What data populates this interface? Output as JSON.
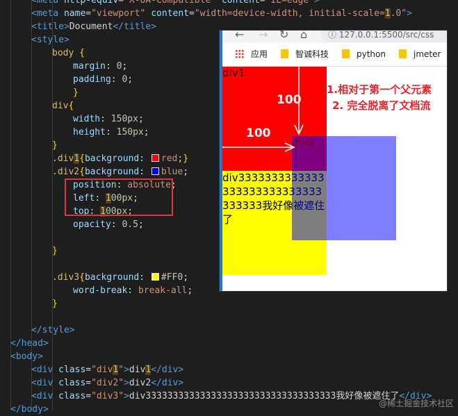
{
  "editor": {
    "lines": [
      [
        [
          "tag",
          "<meta"
        ],
        [
          "attr",
          " http-equiv"
        ],
        [
          "txt",
          "="
        ],
        [
          "str",
          "\"X-UA-Compatible\""
        ],
        [
          "attr",
          " content"
        ],
        [
          "txt",
          "="
        ],
        [
          "str",
          "\"IE=edge\""
        ],
        [
          "tag",
          ">"
        ]
      ],
      [
        [
          "tag",
          "<meta"
        ],
        [
          "attr",
          " name"
        ],
        [
          "txt",
          "="
        ],
        [
          "str",
          "\"viewport\""
        ],
        [
          "attr",
          " content"
        ],
        [
          "txt",
          "="
        ],
        [
          "str",
          "\"width=device-width, initial-scale="
        ],
        [
          "hlnum",
          "1"
        ],
        [
          "str",
          ".0\""
        ],
        [
          "tag",
          ">"
        ]
      ],
      [
        [
          "tag",
          "<title>"
        ],
        [
          "txt",
          "Document"
        ],
        [
          "tag",
          "</title>"
        ]
      ],
      [
        [
          "tag",
          "<style>"
        ]
      ],
      [
        [
          "sel",
          "body"
        ],
        [
          "br",
          " {"
        ]
      ],
      [
        [
          "prop",
          "margin"
        ],
        [
          "txt",
          ": "
        ],
        [
          "num",
          "0"
        ],
        [
          "txt",
          ";"
        ]
      ],
      [
        [
          "prop",
          "padding"
        ],
        [
          "txt",
          ": "
        ],
        [
          "num",
          "0"
        ],
        [
          "txt",
          ";"
        ]
      ],
      [
        [
          "br",
          "}"
        ]
      ],
      [
        [
          "sel",
          "div"
        ],
        [
          "br",
          "{"
        ]
      ],
      [
        [
          "prop",
          "width"
        ],
        [
          "txt",
          ": "
        ],
        [
          "num",
          "150px"
        ],
        [
          "txt",
          ";"
        ]
      ],
      [
        [
          "prop",
          "height"
        ],
        [
          "txt",
          ": "
        ],
        [
          "num",
          "150px"
        ],
        [
          "txt",
          ";"
        ]
      ],
      [
        [
          "br",
          "}"
        ]
      ],
      [
        [
          "sel",
          ".div"
        ],
        [
          "hlnum",
          "1"
        ],
        [
          "br",
          "{"
        ],
        [
          "prop",
          "background"
        ],
        [
          "txt",
          ": "
        ],
        [
          "swatch",
          "#ff0000"
        ],
        [
          "val",
          "red"
        ],
        [
          "txt",
          ";"
        ],
        [
          "br",
          "}"
        ]
      ],
      [
        [
          "sel",
          ".div2"
        ],
        [
          "br",
          "{"
        ],
        [
          "prop",
          "background"
        ],
        [
          "txt",
          ": "
        ],
        [
          "swatch",
          "#0000ff"
        ],
        [
          "val",
          "blue"
        ],
        [
          "txt",
          ";"
        ]
      ],
      [
        [
          "prop",
          "position"
        ],
        [
          "txt",
          ": "
        ],
        [
          "val",
          "absolute"
        ],
        [
          "txt",
          ";"
        ]
      ],
      [
        [
          "prop",
          "left"
        ],
        [
          "txt",
          ": "
        ],
        [
          "hlnum",
          "1"
        ],
        [
          "num",
          "00px"
        ],
        [
          "txt",
          ";"
        ]
      ],
      [
        [
          "prop",
          "top"
        ],
        [
          "txt",
          ": "
        ],
        [
          "hlnum",
          "1"
        ],
        [
          "num",
          "00px"
        ],
        [
          "txt",
          ";"
        ]
      ],
      [
        [
          "prop",
          "opacity"
        ],
        [
          "txt",
          ": "
        ],
        [
          "num",
          "0.5"
        ],
        [
          "txt",
          ";"
        ]
      ],
      [],
      [
        [
          "br",
          "}"
        ]
      ],
      [],
      [
        [
          "sel",
          ".div3"
        ],
        [
          "br",
          "{"
        ],
        [
          "prop",
          "background"
        ],
        [
          "txt",
          ": "
        ],
        [
          "swatch",
          "#ffff00"
        ],
        [
          "num",
          "#FF0"
        ],
        [
          "txt",
          ";"
        ]
      ],
      [
        [
          "prop",
          "word-break"
        ],
        [
          "txt",
          ": "
        ],
        [
          "val",
          "break-all"
        ],
        [
          "txt",
          ";"
        ]
      ],
      [
        [
          "br",
          "}"
        ]
      ],
      [],
      [
        [
          "tag",
          "</style>"
        ]
      ],
      [
        [
          "tag",
          "</head>"
        ]
      ],
      [
        [
          "tag",
          "<body>"
        ]
      ],
      [
        [
          "tag",
          "<div"
        ],
        [
          "attr",
          " class"
        ],
        [
          "txt",
          "="
        ],
        [
          "str",
          "\"div"
        ],
        [
          "hlnum",
          "1"
        ],
        [
          "str",
          "\""
        ],
        [
          "tag",
          ">"
        ],
        [
          "txt",
          "div"
        ],
        [
          "hlnum",
          "1"
        ],
        [
          "tag",
          "</div>"
        ]
      ],
      [
        [
          "tag",
          "<div"
        ],
        [
          "attr",
          " class"
        ],
        [
          "txt",
          "="
        ],
        [
          "str",
          "\"div2\""
        ],
        [
          "tag",
          ">"
        ],
        [
          "txt",
          "div2"
        ],
        [
          "tag",
          "</div>"
        ]
      ],
      [
        [
          "tag",
          "<div"
        ],
        [
          "attr",
          " class"
        ],
        [
          "txt",
          "="
        ],
        [
          "str",
          "\"div3\""
        ],
        [
          "tag",
          ">"
        ],
        [
          "txt",
          "div33333333333333333333333333333333333我好像被遮住了"
        ],
        [
          "tag",
          "</div>"
        ]
      ],
      [
        [
          "tag",
          "</body>"
        ]
      ]
    ],
    "watermark": "@稀土掘金技术社区"
  },
  "browser": {
    "url": "127.0.0.1:5500/src/css",
    "bookmarks": [
      {
        "label": "应用",
        "icon": "apps-grid-icon"
      },
      {
        "label": "智诚科技",
        "icon": "folder-icon"
      },
      {
        "label": "python",
        "icon": "folder-icon"
      },
      {
        "label": "jmeter",
        "icon": "folder-icon"
      }
    ],
    "page": {
      "div1_text": "div1",
      "div2_text": "div2",
      "div3_text": "div3333333333333333333333333333333333我好像被遮住了"
    },
    "annotations": {
      "top_offset_label": "100",
      "left_offset_label": "100",
      "note_line_1": "1.相对于第一个父元素",
      "note_line_2": "2. 完全脱离了文档流"
    }
  },
  "colors": {
    "editor_bg": "#1e1e1e",
    "preview_border": "#1a7ad4",
    "highlight_box": "#d9363e",
    "annotation_red": "#e0262c"
  }
}
